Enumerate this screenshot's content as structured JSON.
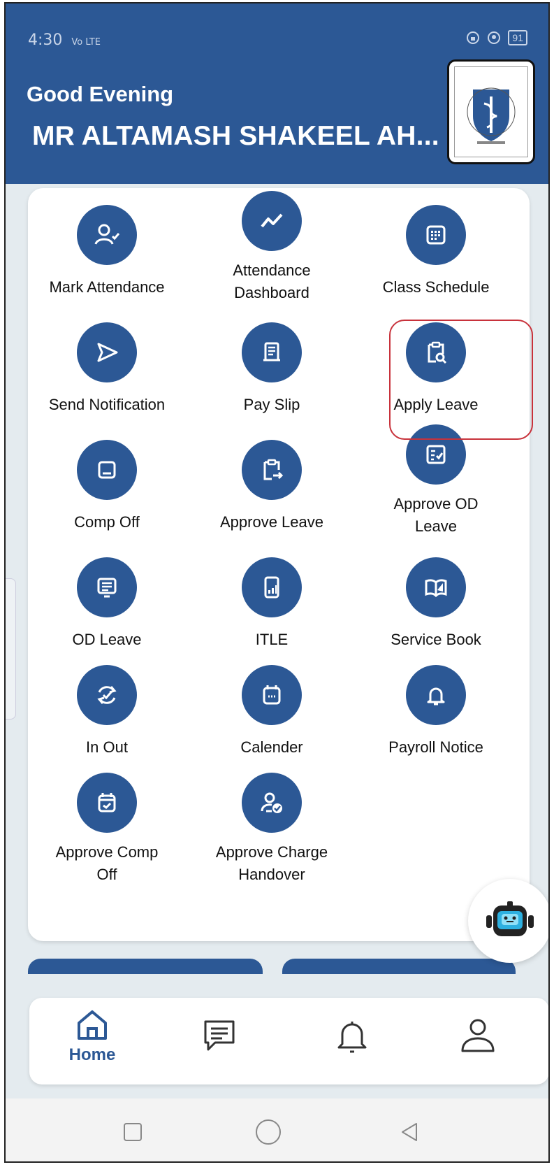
{
  "status_bar": {
    "time": "4:30",
    "network": "Vo LTE",
    "battery": "91"
  },
  "header": {
    "greeting": "Good Evening",
    "user_name": "MR ALTAMASH SHAKEEL AH..."
  },
  "menu": [
    {
      "label": "Mark Attendance",
      "icon": "user-check-icon"
    },
    {
      "label": "Attendance Dashboard",
      "icon": "trend-line-icon"
    },
    {
      "label": "Class Schedule",
      "icon": "calendar-grid-icon"
    },
    {
      "label": "Send Notification",
      "icon": "send-icon"
    },
    {
      "label": "Pay Slip",
      "icon": "receipt-icon"
    },
    {
      "label": "Apply Leave",
      "icon": "clipboard-search-icon"
    },
    {
      "label": "Comp Off",
      "icon": "minus-square-icon"
    },
    {
      "label": "Approve Leave",
      "icon": "clipboard-arrow-icon"
    },
    {
      "label": "Approve OD Leave",
      "icon": "checklist-icon"
    },
    {
      "label": "OD Leave",
      "icon": "monitor-list-icon"
    },
    {
      "label": "ITLE",
      "icon": "phone-chart-icon"
    },
    {
      "label": "Service Book",
      "icon": "open-book-icon"
    },
    {
      "label": "In Out",
      "icon": "sync-check-icon"
    },
    {
      "label": "Calender",
      "icon": "calendar-icon"
    },
    {
      "label": "Payroll Notice",
      "icon": "bell-icon"
    },
    {
      "label": "Approve Comp Off",
      "icon": "calendar-check-icon"
    },
    {
      "label": "Approve Charge Handover",
      "icon": "user-verified-icon"
    }
  ],
  "bottom_nav": {
    "home_label": "Home"
  },
  "colors": {
    "primary": "#2c5895",
    "highlight": "#c8323b",
    "background": "#e4ebef"
  }
}
